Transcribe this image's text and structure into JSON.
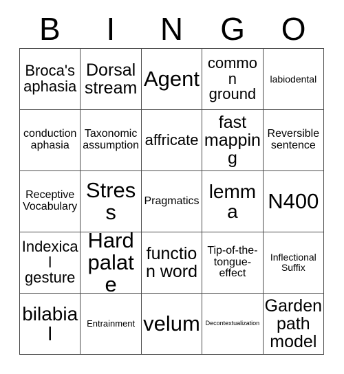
{
  "card": {
    "title": "BINGO",
    "header_letters": [
      "B",
      "I",
      "N",
      "G",
      "O"
    ],
    "rows": [
      [
        {
          "text": "Broca's aphasia",
          "size": "fs-md"
        },
        {
          "text": "Dorsal stream",
          "size": "fs-lg"
        },
        {
          "text": "Agent",
          "size": "fs-xxl"
        },
        {
          "text": "common ground",
          "size": "fs-md"
        },
        {
          "text": "labiodental",
          "size": "fs-xs"
        }
      ],
      [
        {
          "text": "conduction aphasia",
          "size": "fs-sm"
        },
        {
          "text": "Taxonomic assumption",
          "size": "fs-sm"
        },
        {
          "text": "affricate",
          "size": "fs-md"
        },
        {
          "text": "fast mapping",
          "size": "fs-lg"
        },
        {
          "text": "Reversible sentence",
          "size": "fs-sm"
        }
      ],
      [
        {
          "text": "Receptive Vocabulary",
          "size": "fs-sm"
        },
        {
          "text": "Stress",
          "size": "fs-xxl"
        },
        {
          "text": "Pragmatics",
          "size": "fs-sm"
        },
        {
          "text": "lemma",
          "size": "fs-xl"
        },
        {
          "text": "N400",
          "size": "fs-xxl"
        }
      ],
      [
        {
          "text": "Indexical gesture",
          "size": "fs-md"
        },
        {
          "text": "Hard palate",
          "size": "fs-xxl"
        },
        {
          "text": "function word",
          "size": "fs-lg"
        },
        {
          "text": "Tip-of-the-tongue-effect",
          "size": "fs-sm"
        },
        {
          "text": "Inflectional Suffix",
          "size": "fs-xs"
        }
      ],
      [
        {
          "text": "bilabial",
          "size": "fs-xl"
        },
        {
          "text": "Entrainment",
          "size": "fs-xxs"
        },
        {
          "text": "velum",
          "size": "fs-xxl"
        },
        {
          "text": "Decontextualization",
          "size": "fs-tiny"
        },
        {
          "text": "Garden path model",
          "size": "fs-lg"
        }
      ]
    ]
  }
}
